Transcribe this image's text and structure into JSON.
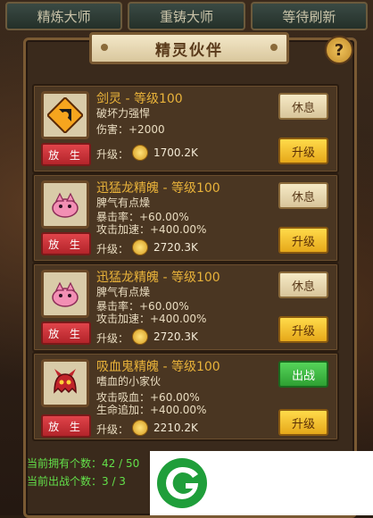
{
  "top_tabs": [
    "精炼大师",
    "重铸大师",
    "等待刷新"
  ],
  "title": "精灵伙伴",
  "help_label": "?",
  "cards": [
    {
      "icon": "sword-spirit-icon",
      "name": "剑灵 - 等级100",
      "lines": [
        "破坏力强悍",
        "伤害：+2000"
      ],
      "release_label": "放 生",
      "upgrade_label": "升级：",
      "cost": "1700.2K",
      "action_label": "休息",
      "upgrade_button": "升级"
    },
    {
      "icon": "pink-raptor-icon",
      "name": "迅猛龙精魄 - 等级100",
      "lines": [
        "脾气有点燥",
        "暴击率：+60.00%",
        "攻击加速：+400.00%"
      ],
      "release_label": "放 生",
      "upgrade_label": "升级：",
      "cost": "2720.3K",
      "action_label": "休息",
      "upgrade_button": "升级"
    },
    {
      "icon": "pink-raptor-icon",
      "name": "迅猛龙精魄 - 等级100",
      "lines": [
        "脾气有点燥",
        "暴击率：+60.00%",
        "攻击加速：+400.00%"
      ],
      "release_label": "放 生",
      "upgrade_label": "升级：",
      "cost": "2720.3K",
      "action_label": "休息",
      "upgrade_button": "升级"
    },
    {
      "icon": "vampire-ghost-icon",
      "name": "吸血鬼精魄 - 等级100",
      "lines": [
        "嗜血的小家伙",
        "攻击吸血：+60.00%",
        "生命追加：+400.00%"
      ],
      "release_label": "放 生",
      "upgrade_label": "升级：",
      "cost": "2210.2K",
      "action_label": "出战",
      "upgrade_button": "升级"
    }
  ],
  "owned_text": "当前拥有个数：42 / 50",
  "deployed_text": "当前出战个数：3 / 3",
  "colors": {
    "gold_text": "#e8b23a",
    "green_text": "#63e04a",
    "release_red": "#d6363c",
    "fight_green": "#3fb843"
  }
}
